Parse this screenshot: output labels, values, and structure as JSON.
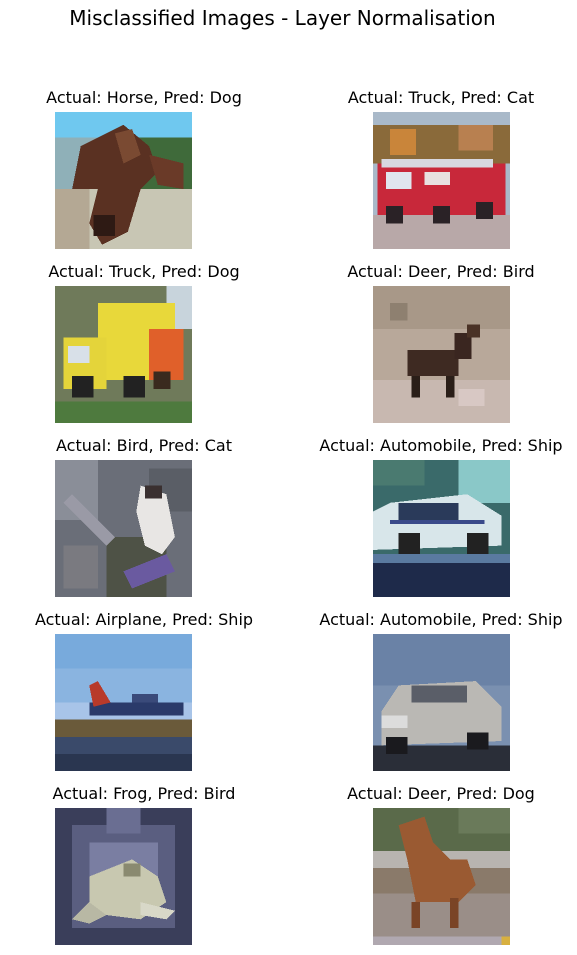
{
  "figure": {
    "title": "Misclassified Images - Layer Normalisation"
  },
  "panels": [
    {
      "caption": "Actual: Horse, Pred: Dog",
      "actual": "Horse",
      "pred": "Dog",
      "image_icon": "horse-photo"
    },
    {
      "caption": "Actual: Truck, Pred: Cat",
      "actual": "Truck",
      "pred": "Cat",
      "image_icon": "fire-truck-photo"
    },
    {
      "caption": "Actual: Truck, Pred: Dog",
      "actual": "Truck",
      "pred": "Dog",
      "image_icon": "yellow-truck-photo"
    },
    {
      "caption": "Actual: Deer, Pred: Bird",
      "actual": "Deer",
      "pred": "Bird",
      "image_icon": "deer-photo"
    },
    {
      "caption": "Actual: Bird, Pred: Cat",
      "actual": "Bird",
      "pred": "Cat",
      "image_icon": "bird-photo"
    },
    {
      "caption": "Actual: Automobile, Pred: Ship",
      "actual": "Automobile",
      "pred": "Ship",
      "image_icon": "police-car-photo"
    },
    {
      "caption": "Actual: Airplane, Pred: Ship",
      "actual": "Airplane",
      "pred": "Ship",
      "image_icon": "airplane-photo"
    },
    {
      "caption": "Actual: Automobile, Pred: Ship",
      "actual": "Automobile",
      "pred": "Ship",
      "image_icon": "silver-car-photo"
    },
    {
      "caption": "Actual: Frog, Pred: Bird",
      "actual": "Frog",
      "pred": "Bird",
      "image_icon": "frog-photo"
    },
    {
      "caption": "Actual: Deer, Pred: Dog",
      "actual": "Deer",
      "pred": "Dog",
      "image_icon": "deer-on-road-photo"
    }
  ]
}
